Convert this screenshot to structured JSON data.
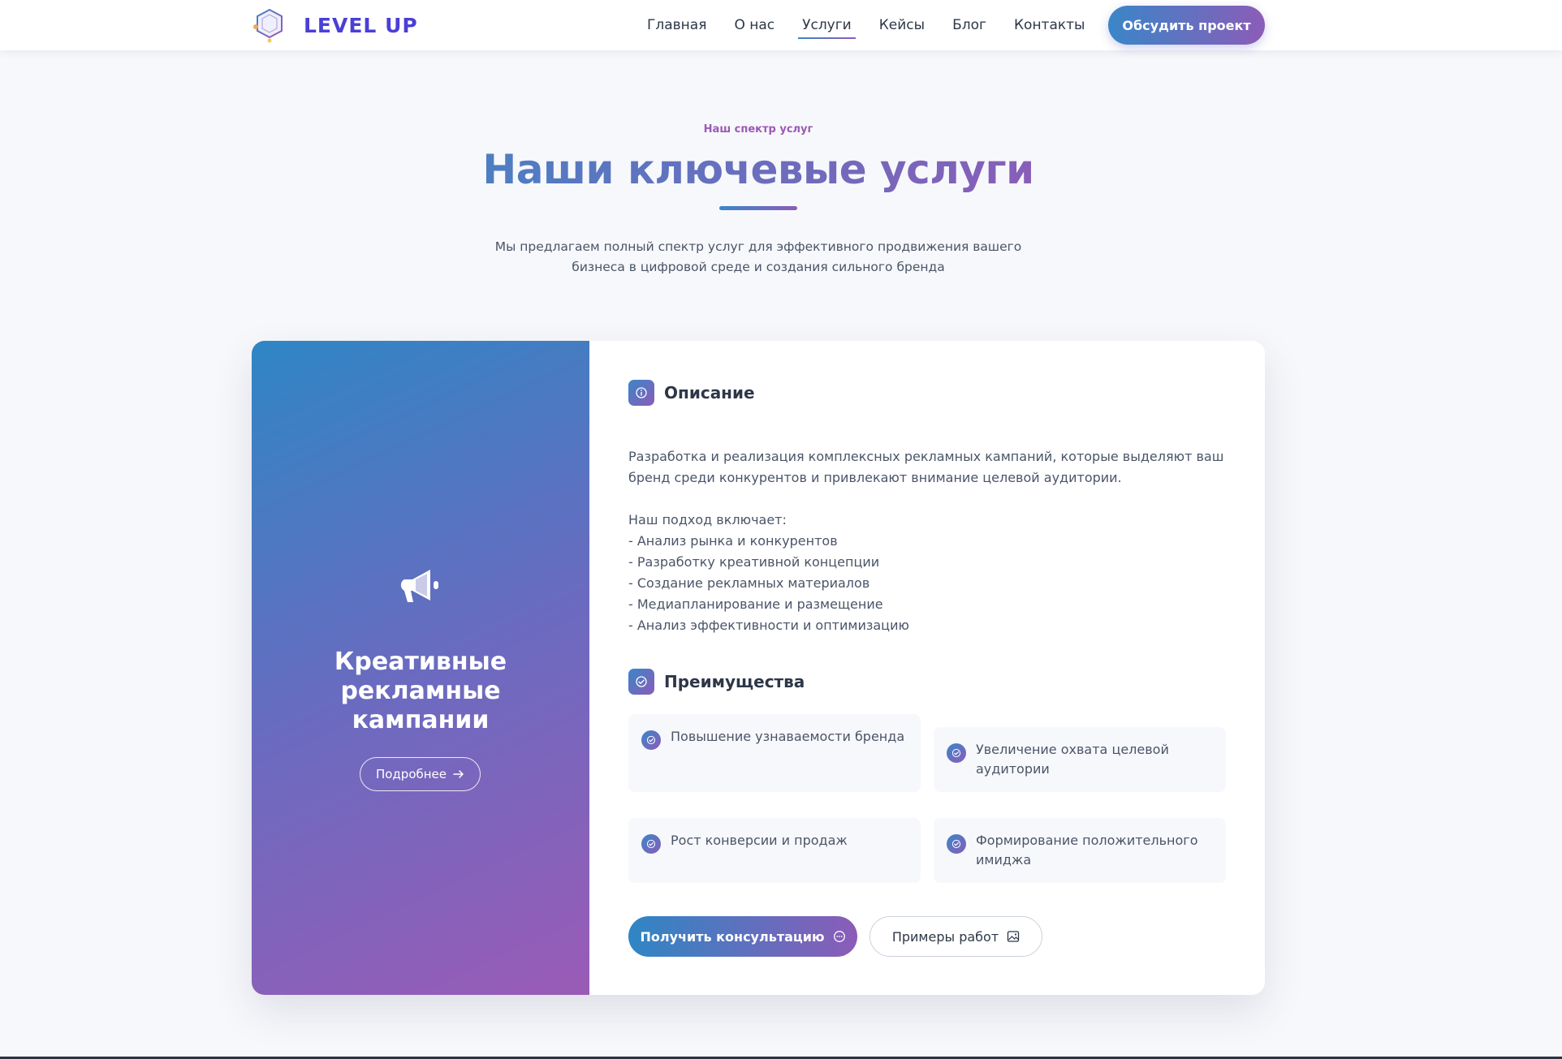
{
  "header": {
    "logo_text": "LEVEL UP",
    "nav": [
      {
        "label": "Главная",
        "active": false
      },
      {
        "label": "О нас",
        "active": false
      },
      {
        "label": "Услуги",
        "active": true
      },
      {
        "label": "Кейсы",
        "active": false
      },
      {
        "label": "Блог",
        "active": false
      },
      {
        "label": "Контакты",
        "active": false
      }
    ],
    "cta_label": "Обсудить проект"
  },
  "hero": {
    "eyebrow": "Наш спектр услуг",
    "title": "Наши ключевые услуги",
    "subtitle": "Мы предлагаем полный спектр услуг для эффективного продвижения вашего бизнеса в цифровой среде и создания сильного бренда"
  },
  "service": {
    "icon": "megaphone-icon",
    "title": "Креативные рекламные кампании",
    "more_label": "Подробнее",
    "description_heading": "Описание",
    "description_intro": "Разработка и реализация комплексных рекламных кампаний, которые выделяют ваш бренд среди конкурентов и привлекают внимание целевой аудитории.",
    "approach_heading": "Наш подход включает:",
    "approach_items": [
      "- Анализ рынка и конкурентов",
      "- Разработку креативной концепции",
      "- Создание рекламных материалов",
      "- Медиапланирование и размещение",
      "- Анализ эффективности и оптимизацию"
    ],
    "benefits_heading": "Преимущества",
    "benefits": [
      "Повышение узнаваемости бренда",
      "Увеличение охвата целевой аудитории",
      "Рост конверсии и продаж",
      "Формирование положительного имиджа"
    ],
    "primary_button": "Получить консультацию",
    "secondary_button": "Примеры работ"
  },
  "colors": {
    "accent_blue": "#3a86c8",
    "accent_purple": "#8b5cb8",
    "logo_text": "#4a3fd6",
    "background": "#f7f8fb"
  }
}
